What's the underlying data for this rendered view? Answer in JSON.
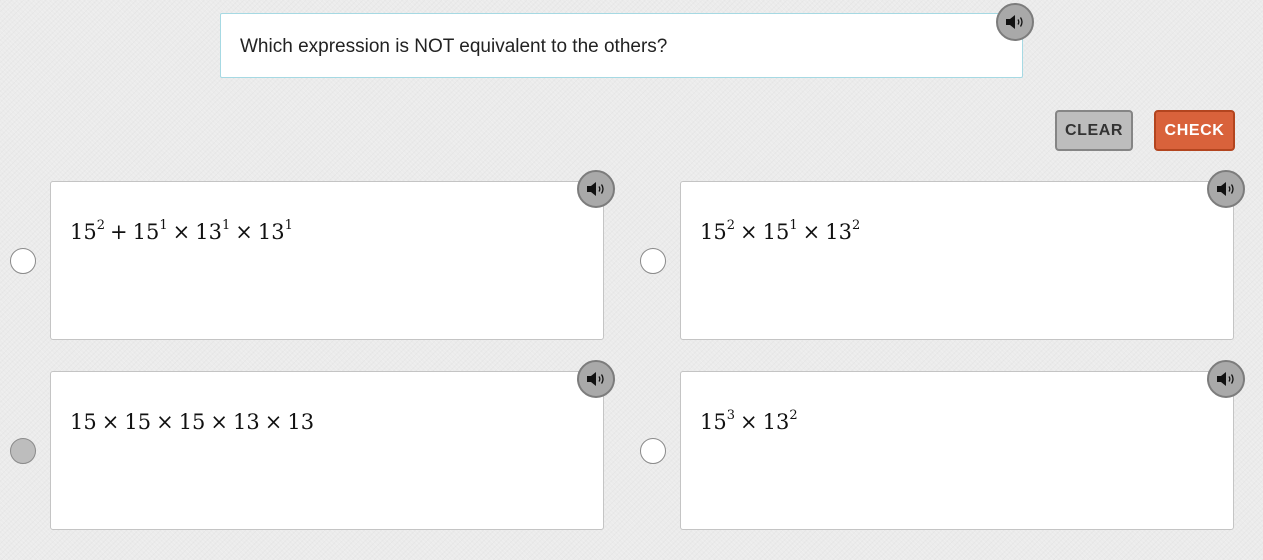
{
  "question": {
    "text": "Which expression is NOT equivalent to the others?",
    "audio_icon": "speaker-icon"
  },
  "buttons": {
    "clear_label": "CLEAR",
    "check_label": "CHECK"
  },
  "colors": {
    "check_bg": "#d9623b",
    "clear_bg": "#bdbdbd",
    "prompt_border": "#a6d9e3",
    "selected_radio": "#bdbdbd"
  },
  "options": [
    {
      "id": "a",
      "selected": false,
      "terms": [
        {
          "base": "15",
          "exp": "2"
        },
        {
          "op": "+"
        },
        {
          "base": "15",
          "exp": "1"
        },
        {
          "op": "×"
        },
        {
          "base": "13",
          "exp": "1"
        },
        {
          "op": "×"
        },
        {
          "base": "13",
          "exp": "1"
        }
      ]
    },
    {
      "id": "b",
      "selected": false,
      "terms": [
        {
          "base": "15",
          "exp": "2"
        },
        {
          "op": "×"
        },
        {
          "base": "15",
          "exp": "1"
        },
        {
          "op": "×"
        },
        {
          "base": "13",
          "exp": "2"
        }
      ]
    },
    {
      "id": "c",
      "selected": true,
      "terms": [
        {
          "base": "15"
        },
        {
          "op": "×"
        },
        {
          "base": "15"
        },
        {
          "op": "×"
        },
        {
          "base": "15"
        },
        {
          "op": "×"
        },
        {
          "base": "13"
        },
        {
          "op": "×"
        },
        {
          "base": "13"
        }
      ]
    },
    {
      "id": "d",
      "selected": false,
      "terms": [
        {
          "base": "15",
          "exp": "3"
        },
        {
          "op": "×"
        },
        {
          "base": "13",
          "exp": "2"
        }
      ]
    }
  ]
}
